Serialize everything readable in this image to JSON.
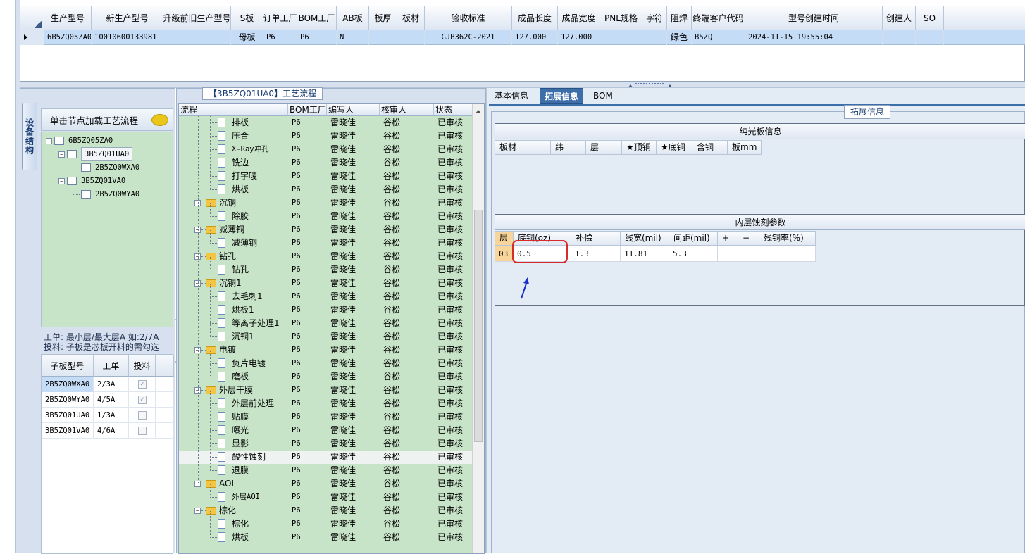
{
  "top_grid": {
    "columns": [
      "生产型号",
      "新生产型号",
      "升级前旧生产型号",
      "S板",
      "订单工厂",
      "BOM工厂",
      "AB板",
      "板厚",
      "板材",
      "验收标准",
      "成品长度",
      "成品宽度",
      "PNL规格",
      "字符",
      "阻焊",
      "终端客户代码",
      "型号创建时间",
      "创建人",
      "SO"
    ],
    "row": {
      "prod_model": "6B5ZQ05ZA0",
      "new_prod_model": "10010600133981",
      "old_model": "",
      "s_board": "母板",
      "order_factory": "P6",
      "bom_factory": "P6",
      "ab_board": "N",
      "thickness": "",
      "material": "",
      "standard": "GJB362C-2021",
      "length": "127.000",
      "width": "127.000",
      "pnl": "",
      "char": "",
      "solder_mask": "绿色",
      "customer_code": "B5ZQ",
      "created_time": "2024-11-15 19:55:04",
      "creator": "",
      "so": ""
    }
  },
  "left_panel": {
    "vertical_tab": "设备结构",
    "tree_header": "单击节点加载工艺流程",
    "tree": [
      {
        "label": "6B5ZQ05ZA0",
        "level": 0
      },
      {
        "label": "3B5ZQ01UA0",
        "level": 1
      },
      {
        "label": "2B5ZQ0WXA0",
        "level": 2
      },
      {
        "label": "3B5ZQ01VA0",
        "level": 1
      },
      {
        "label": "2B5ZQ0WYA0",
        "level": 2
      }
    ],
    "note_line1": "工单: 最小层/最大层A 如:2/7A",
    "note_line2": "投料: 子板是芯板开料的需勾选",
    "sub_headers": [
      "子板型号",
      "工单",
      "投料"
    ],
    "sub_rows": [
      {
        "model": "2B5ZQ0WXA0",
        "order": "2/3A",
        "feed": true
      },
      {
        "model": "2B5ZQ0WYA0",
        "order": "4/5A",
        "feed": true
      },
      {
        "model": "3B5ZQ01UA0",
        "order": "1/3A",
        "feed": false
      },
      {
        "model": "3B5ZQ01VA0",
        "order": "4/6A",
        "feed": false
      }
    ]
  },
  "process": {
    "title": "【3B5ZQ01UA0】工艺流程",
    "headers": [
      "流程",
      "BOM工厂",
      "编写人",
      "核审人",
      "状态"
    ],
    "rows": [
      {
        "name": "排板",
        "type": "child",
        "factory": "P6",
        "writer": "雷晓佳",
        "reviewer": "谷松",
        "status": "已审核"
      },
      {
        "name": "压合",
        "type": "child",
        "factory": "P6",
        "writer": "雷晓佳",
        "reviewer": "谷松",
        "status": "已审核"
      },
      {
        "name": "X-Ray冲孔",
        "type": "child",
        "factory": "P6",
        "writer": "雷晓佳",
        "reviewer": "谷松",
        "status": "已审核"
      },
      {
        "name": "铣边",
        "type": "child",
        "factory": "P6",
        "writer": "雷晓佳",
        "reviewer": "谷松",
        "status": "已审核"
      },
      {
        "name": "打字唛",
        "type": "child",
        "factory": "P6",
        "writer": "雷晓佳",
        "reviewer": "谷松",
        "status": "已审核"
      },
      {
        "name": "烘板",
        "type": "child",
        "factory": "P6",
        "writer": "雷晓佳",
        "reviewer": "谷松",
        "status": "已审核"
      },
      {
        "name": "沉铜",
        "type": "group",
        "factory": "P6",
        "writer": "雷晓佳",
        "reviewer": "谷松",
        "status": "已审核"
      },
      {
        "name": "除胶",
        "type": "child",
        "factory": "P6",
        "writer": "雷晓佳",
        "reviewer": "谷松",
        "status": "已审核"
      },
      {
        "name": "减薄铜",
        "type": "group",
        "factory": "P6",
        "writer": "雷晓佳",
        "reviewer": "谷松",
        "status": "已审核"
      },
      {
        "name": "减薄铜",
        "type": "child",
        "factory": "P6",
        "writer": "雷晓佳",
        "reviewer": "谷松",
        "status": "已审核"
      },
      {
        "name": "钻孔",
        "type": "group",
        "factory": "P6",
        "writer": "雷晓佳",
        "reviewer": "谷松",
        "status": "已审核"
      },
      {
        "name": "钻孔",
        "type": "child",
        "factory": "P6",
        "writer": "雷晓佳",
        "reviewer": "谷松",
        "status": "已审核"
      },
      {
        "name": "沉铜1",
        "type": "group",
        "factory": "P6",
        "writer": "雷晓佳",
        "reviewer": "谷松",
        "status": "已审核"
      },
      {
        "name": "去毛刺1",
        "type": "child",
        "factory": "P6",
        "writer": "雷晓佳",
        "reviewer": "谷松",
        "status": "已审核"
      },
      {
        "name": "烘板1",
        "type": "child",
        "factory": "P6",
        "writer": "雷晓佳",
        "reviewer": "谷松",
        "status": "已审核"
      },
      {
        "name": "等离子处理1",
        "type": "child",
        "factory": "P6",
        "writer": "雷晓佳",
        "reviewer": "谷松",
        "status": "已审核"
      },
      {
        "name": "沉铜1",
        "type": "child",
        "factory": "P6",
        "writer": "雷晓佳",
        "reviewer": "谷松",
        "status": "已审核"
      },
      {
        "name": "电镀",
        "type": "group",
        "factory": "P6",
        "writer": "雷晓佳",
        "reviewer": "谷松",
        "status": "已审核"
      },
      {
        "name": "负片电镀",
        "type": "child",
        "factory": "P6",
        "writer": "雷晓佳",
        "reviewer": "谷松",
        "status": "已审核"
      },
      {
        "name": "磨板",
        "type": "child",
        "factory": "P6",
        "writer": "雷晓佳",
        "reviewer": "谷松",
        "status": "已审核"
      },
      {
        "name": "外层干膜",
        "type": "group",
        "factory": "P6",
        "writer": "雷晓佳",
        "reviewer": "谷松",
        "status": "已审核"
      },
      {
        "name": "外层前处理",
        "type": "child",
        "factory": "P6",
        "writer": "雷晓佳",
        "reviewer": "谷松",
        "status": "已审核"
      },
      {
        "name": "贴膜",
        "type": "child",
        "factory": "P6",
        "writer": "雷晓佳",
        "reviewer": "谷松",
        "status": "已审核"
      },
      {
        "name": "曝光",
        "type": "child",
        "factory": "P6",
        "writer": "雷晓佳",
        "reviewer": "谷松",
        "status": "已审核"
      },
      {
        "name": "显影",
        "type": "child",
        "factory": "P6",
        "writer": "雷晓佳",
        "reviewer": "谷松",
        "status": "已审核"
      },
      {
        "name": "酸性蚀刻",
        "type": "child",
        "factory": "P6",
        "writer": "雷晓佳",
        "reviewer": "谷松",
        "status": "已审核",
        "selected": true
      },
      {
        "name": "退膜",
        "type": "child",
        "factory": "P6",
        "writer": "雷晓佳",
        "reviewer": "谷松",
        "status": "已审核"
      },
      {
        "name": "AOI",
        "type": "group",
        "factory": "P6",
        "writer": "雷晓佳",
        "reviewer": "谷松",
        "status": "已审核"
      },
      {
        "name": "外层AOI",
        "type": "child",
        "factory": "P6",
        "writer": "雷晓佳",
        "reviewer": "谷松",
        "status": "已审核"
      },
      {
        "name": "棕化",
        "type": "group",
        "factory": "P6",
        "writer": "雷晓佳",
        "reviewer": "谷松",
        "status": "已审核"
      },
      {
        "name": "棕化",
        "type": "child",
        "factory": "P6",
        "writer": "雷晓佳",
        "reviewer": "谷松",
        "status": "已审核"
      },
      {
        "name": "烘板",
        "type": "child",
        "factory": "P6",
        "writer": "雷晓佳",
        "reviewer": "谷松",
        "status": "已审核"
      }
    ]
  },
  "right_panel": {
    "tabs": [
      "基本信息",
      "拓展信息",
      "BOM"
    ],
    "active_tab": 1,
    "group_title": "拓展信息",
    "bare_board": {
      "title": "纯光板信息",
      "headers": [
        "板材",
        "纬",
        "层",
        "★顶铜",
        "★底铜",
        "含铜",
        "板mm"
      ]
    },
    "etch": {
      "title": "内层蚀刻参数",
      "headers": [
        "层",
        "底铜(oz)",
        "补偿",
        "线宽(mil)",
        "间距(mil)",
        "+",
        "−",
        "残铜率(%)"
      ],
      "rows": [
        {
          "layer": "03",
          "base_copper": "0.5",
          "comp": "1.3",
          "line_width": "11.81",
          "spacing": "5.3",
          "plus": "",
          "minus": "",
          "residual": ""
        }
      ]
    }
  }
}
